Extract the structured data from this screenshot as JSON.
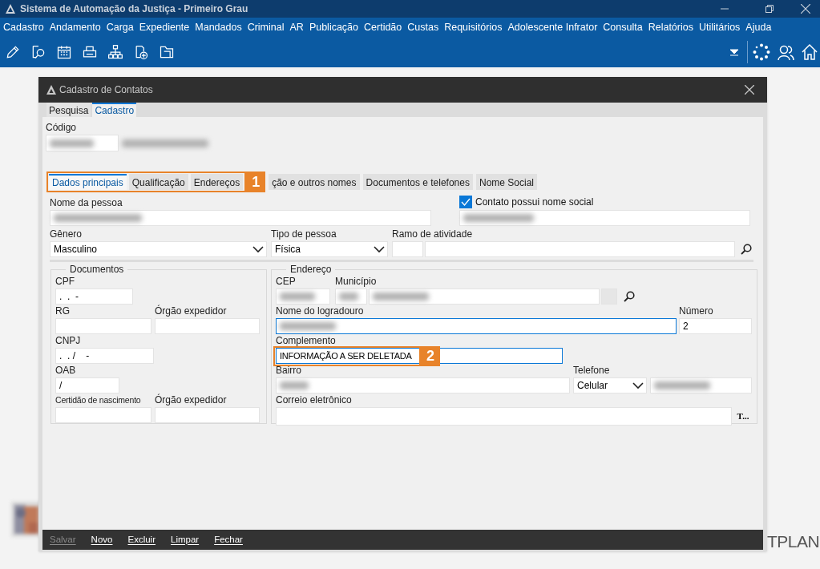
{
  "app": {
    "title": "Sistema de Automação da Justiça - Primeiro Grau",
    "menu": [
      "Cadastro",
      "Andamento",
      "Carga",
      "Expediente",
      "Mandados",
      "Criminal",
      "AR",
      "Publicação",
      "Certidão",
      "Custas",
      "Requisitórios",
      "Adolescente Infrator",
      "Consulta",
      "Relatórios",
      "Utilitários",
      "Ajuda"
    ],
    "logo_text": "TPLAN"
  },
  "dialog": {
    "title": "Cadastro de Contatos",
    "tabs": [
      {
        "label": "Pesquisa",
        "selected": false
      },
      {
        "label": "Cadastro",
        "selected": true
      }
    ],
    "codigo": {
      "label": "Código",
      "blurred": true
    },
    "section_tabs": [
      {
        "label": "Dados principais",
        "selected": true,
        "highlighted": true
      },
      {
        "label": "Qualificação",
        "selected": false,
        "highlighted": true
      },
      {
        "label": "Endereços",
        "selected": false,
        "highlighted": true
      },
      {
        "label": "ção e outros nomes",
        "selected": false,
        "highlighted": false
      },
      {
        "label": "Documentos e telefones",
        "selected": false,
        "highlighted": false
      },
      {
        "label": "Nome Social",
        "selected": false,
        "highlighted": false
      }
    ],
    "tabs_callout": "1",
    "nome_da_pessoa": {
      "label": "Nome da pessoa",
      "blurred": true
    },
    "nome_social": {
      "label": "Contato possui nome social",
      "checked": true,
      "blurred": true
    },
    "genero": {
      "label": "Gênero",
      "value": "Masculino"
    },
    "tipo_de_pessoa": {
      "label": "Tipo de pessoa",
      "value": "Física"
    },
    "ramo_de_atividade": {
      "label": "Ramo de atividade"
    },
    "documentos": {
      "title": "Documentos",
      "cpf": {
        "label": "CPF",
        "value": ".  .  -"
      },
      "rg": {
        "label": "RG"
      },
      "rg_orgao": {
        "label": "Órgão expedidor"
      },
      "cnpj": {
        "label": "CNPJ",
        "value": ".  . /    -"
      },
      "oab": {
        "label": "OAB",
        "value": "/"
      },
      "certidao": {
        "label": "Certidão de nascimento"
      },
      "certidao_orgao": {
        "label": "Órgão expedidor"
      }
    },
    "endereco": {
      "title": "Endereço",
      "cep": {
        "label": "CEP",
        "blurred": true
      },
      "municipio": {
        "label": "Município",
        "blurred": true
      },
      "logradouro": {
        "label": "Nome do logradouro",
        "blurred": true
      },
      "numero": {
        "label": "Número",
        "value": "2"
      },
      "complemento": {
        "label": "Complemento",
        "value": "INFORMAÇÃO A SER DELETADA",
        "callout": "2"
      },
      "bairro": {
        "label": "Bairro",
        "blurred": true
      },
      "telefone": {
        "label": "Telefone",
        "value": "Celular",
        "number_blurred": true
      },
      "correio": {
        "label": "Correio eletrônico",
        "button": "T..."
      }
    },
    "buttons": [
      {
        "label": "Salvar",
        "disabled": true
      },
      {
        "label": "Novo",
        "disabled": false
      },
      {
        "label": "Excluir",
        "disabled": false
      },
      {
        "label": "Limpar",
        "disabled": false
      },
      {
        "label": "Fechar",
        "disabled": false
      }
    ]
  }
}
